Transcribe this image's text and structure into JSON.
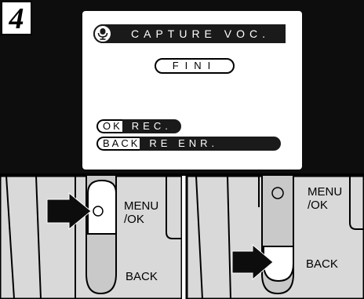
{
  "step": {
    "number": "4"
  },
  "lcd": {
    "title": "CAPTURE VOC.",
    "mic_icon": "microphone-icon",
    "fini_label": "FINI",
    "ok_key": "OK",
    "ok_action": "REC.",
    "back_key": "BACK",
    "back_action": "RE ENR."
  },
  "left_photo": {
    "menu_label": "MENU\n/OK",
    "back_label": "BACK",
    "arrow_icon": "pointing-arrow-icon"
  },
  "right_photo": {
    "menu_label": "MENU\n/OK",
    "back_label": "BACK",
    "arrow_icon": "pointing-arrow-icon"
  }
}
